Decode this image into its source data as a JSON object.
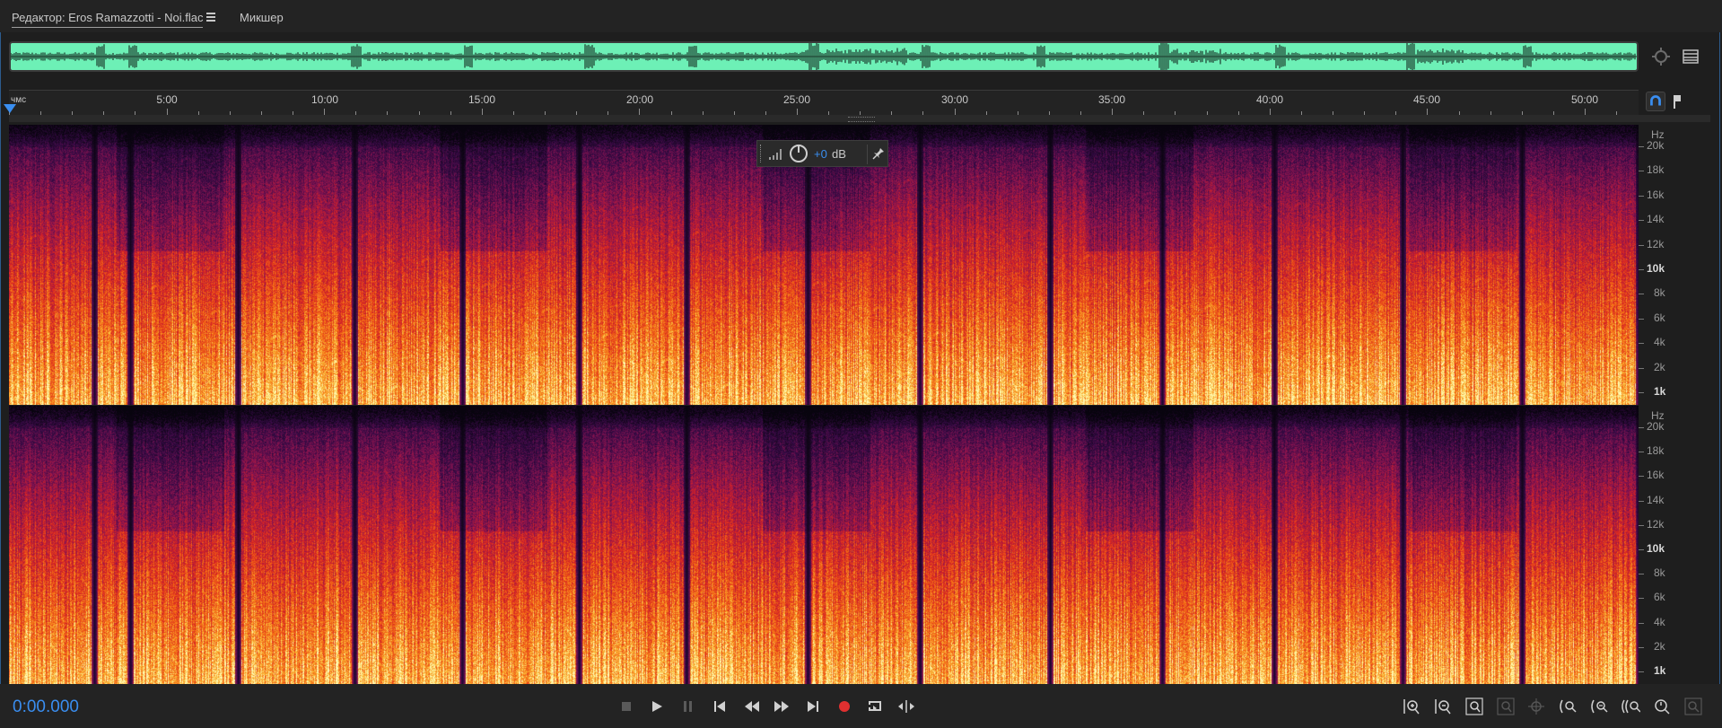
{
  "header": {
    "editor_tab": "Редактор: Eros Ramazzotti - Noi.flac",
    "mixer_tab": "Микшер"
  },
  "ruler": {
    "units": "чмс",
    "ticks": [
      "5:00",
      "10:00",
      "15:00",
      "20:00",
      "25:00",
      "30:00",
      "35:00",
      "40:00",
      "45:00",
      "50:00"
    ]
  },
  "hud": {
    "gain_value": "+0",
    "gain_unit": "dB"
  },
  "hz_axis": {
    "title": "Hz",
    "labels": [
      "20k",
      "18k",
      "16k",
      "14k",
      "12k",
      "10k",
      "8k",
      "6k",
      "4k",
      "2k",
      "1k"
    ]
  },
  "transport": {
    "timecode": "0:00.000"
  },
  "colors": {
    "accent": "#3a8ef0",
    "overview_wave_bg": "#6df0b6",
    "record": "#e03030"
  },
  "icons": {
    "tab_menu": "hamburger-icon",
    "overview_zoom": "zoom-crosshair-icon",
    "overview_panel": "panel-list-icon",
    "snap": "magnet-icon",
    "marker": "marker-flag-icon",
    "stop": "stop-icon",
    "play": "play-icon",
    "pause": "pause-icon",
    "to_start": "skip-to-start-icon",
    "rewind": "rewind-icon",
    "fast_forward": "fast-forward-icon",
    "to_end": "skip-to-end-icon",
    "record": "record-icon",
    "loop": "loop-playback-icon",
    "skip_selection": "skip-selection-icon"
  }
}
